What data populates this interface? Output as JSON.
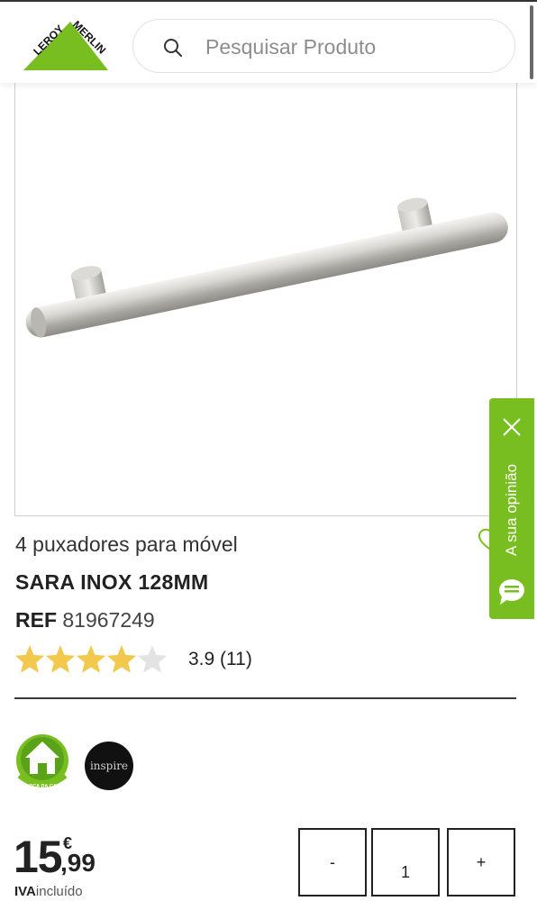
{
  "header": {
    "brand": "LEROY MERLIN",
    "search_placeholder": "Pesquisar Produto",
    "search_icon": "search-icon"
  },
  "product": {
    "name": "4 puxadores para móvel",
    "model": "SARA INOX 128MM",
    "ref_label": "REF",
    "ref_value": "81967249",
    "rating_text": "3.9 (11)",
    "rating_value": 3.9,
    "stars_max": 5,
    "review_count": 11
  },
  "badges": {
    "casa": "MARCA DA CASA",
    "inspire": "inspire"
  },
  "price": {
    "integer": "15",
    "decimal": ",99",
    "currency": "€",
    "vat_bold": "IVA",
    "vat_rest": "incluído"
  },
  "quantity": {
    "minus": "-",
    "value": "1",
    "plus": "+"
  },
  "feedback": {
    "label": "A sua opinião"
  },
  "colors": {
    "brand_green": "#78be20",
    "star_filled": "#f2c94c",
    "star_empty": "#e3e3e3"
  }
}
